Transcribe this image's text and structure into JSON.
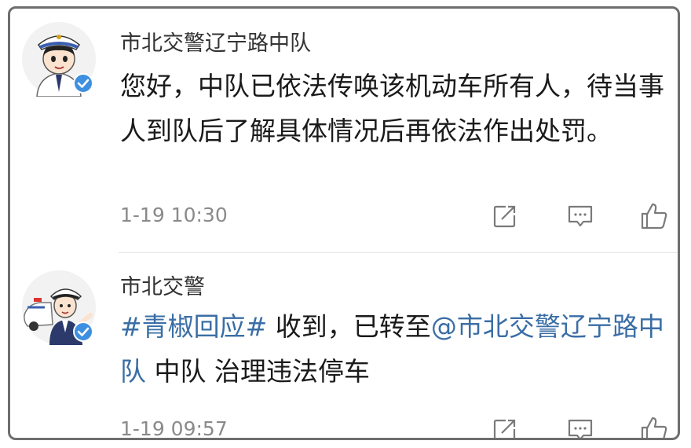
{
  "comments": [
    {
      "author": "市北交警辽宁路中队",
      "avatar_icon": "traffic-police-avatar-icon",
      "verified_icon": "verified-badge-icon",
      "body": "您好，中队已依法传唤该机动车所有人，待当事人到队后了解具体情况后再依法作出处罚。",
      "timestamp": "1-19 10:30",
      "actions": {
        "share_icon": "share-icon",
        "comment_icon": "comment-icon",
        "like_icon": "thumbs-up-icon"
      }
    },
    {
      "author": "市北交警",
      "avatar_icon": "traffic-police-car-avatar-icon",
      "verified_icon": "verified-badge-icon",
      "body_parts": {
        "hashtag": "#青椒回应#",
        "text1": " 收到，已转至",
        "mention": "@市北交警辽宁路中队",
        "text2": " 中队 治理违法停车"
      },
      "timestamp": "1-19 09:57",
      "actions": {
        "share_icon": "share-icon",
        "comment_icon": "comment-icon",
        "like_icon": "thumbs-up-icon"
      }
    }
  ],
  "colors": {
    "link": "#3a6ea5",
    "verified": "#3f8fe0",
    "text": "#1a1a1a",
    "meta": "#8a8a8a"
  }
}
